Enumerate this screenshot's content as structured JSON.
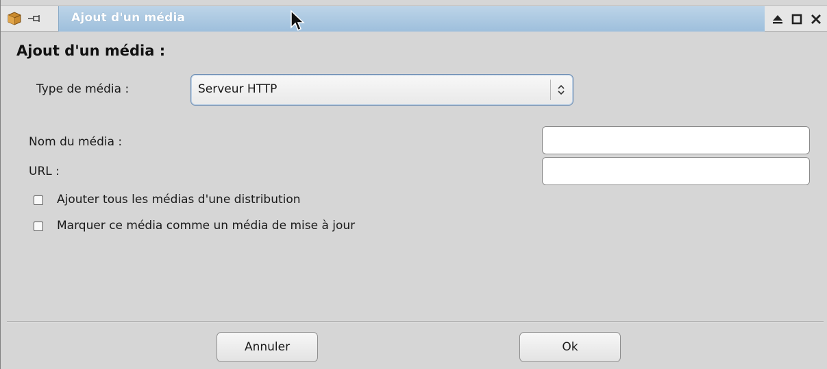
{
  "window": {
    "title": "Ajout d'un média"
  },
  "dialog": {
    "heading": "Ajout d'un média :",
    "media_type": {
      "label": "Type de média :",
      "selected": "Serveur HTTP"
    },
    "name_field": {
      "label": "Nom du média :",
      "value": ""
    },
    "url_field": {
      "label": "URL :",
      "value": ""
    },
    "checkboxes": [
      {
        "label": "Ajouter tous les médias d'une distribution",
        "checked": false
      },
      {
        "label": "Marquer ce média comme un média de mise à jour",
        "checked": false
      }
    ],
    "buttons": {
      "cancel": "Annuler",
      "ok": "Ok"
    }
  },
  "icons": {
    "app": "package-box-icon",
    "pin": "pin-icon",
    "eject": "eject-icon",
    "maximize": "maximize-icon",
    "close": "close-icon",
    "combo_arrow": "up-down-chevron-icon",
    "cursor": "mouse-cursor-icon"
  },
  "colors": {
    "title_tab": "#a9c6e0",
    "background": "#d6d6d6",
    "combo_border": "#6f8fb4"
  }
}
